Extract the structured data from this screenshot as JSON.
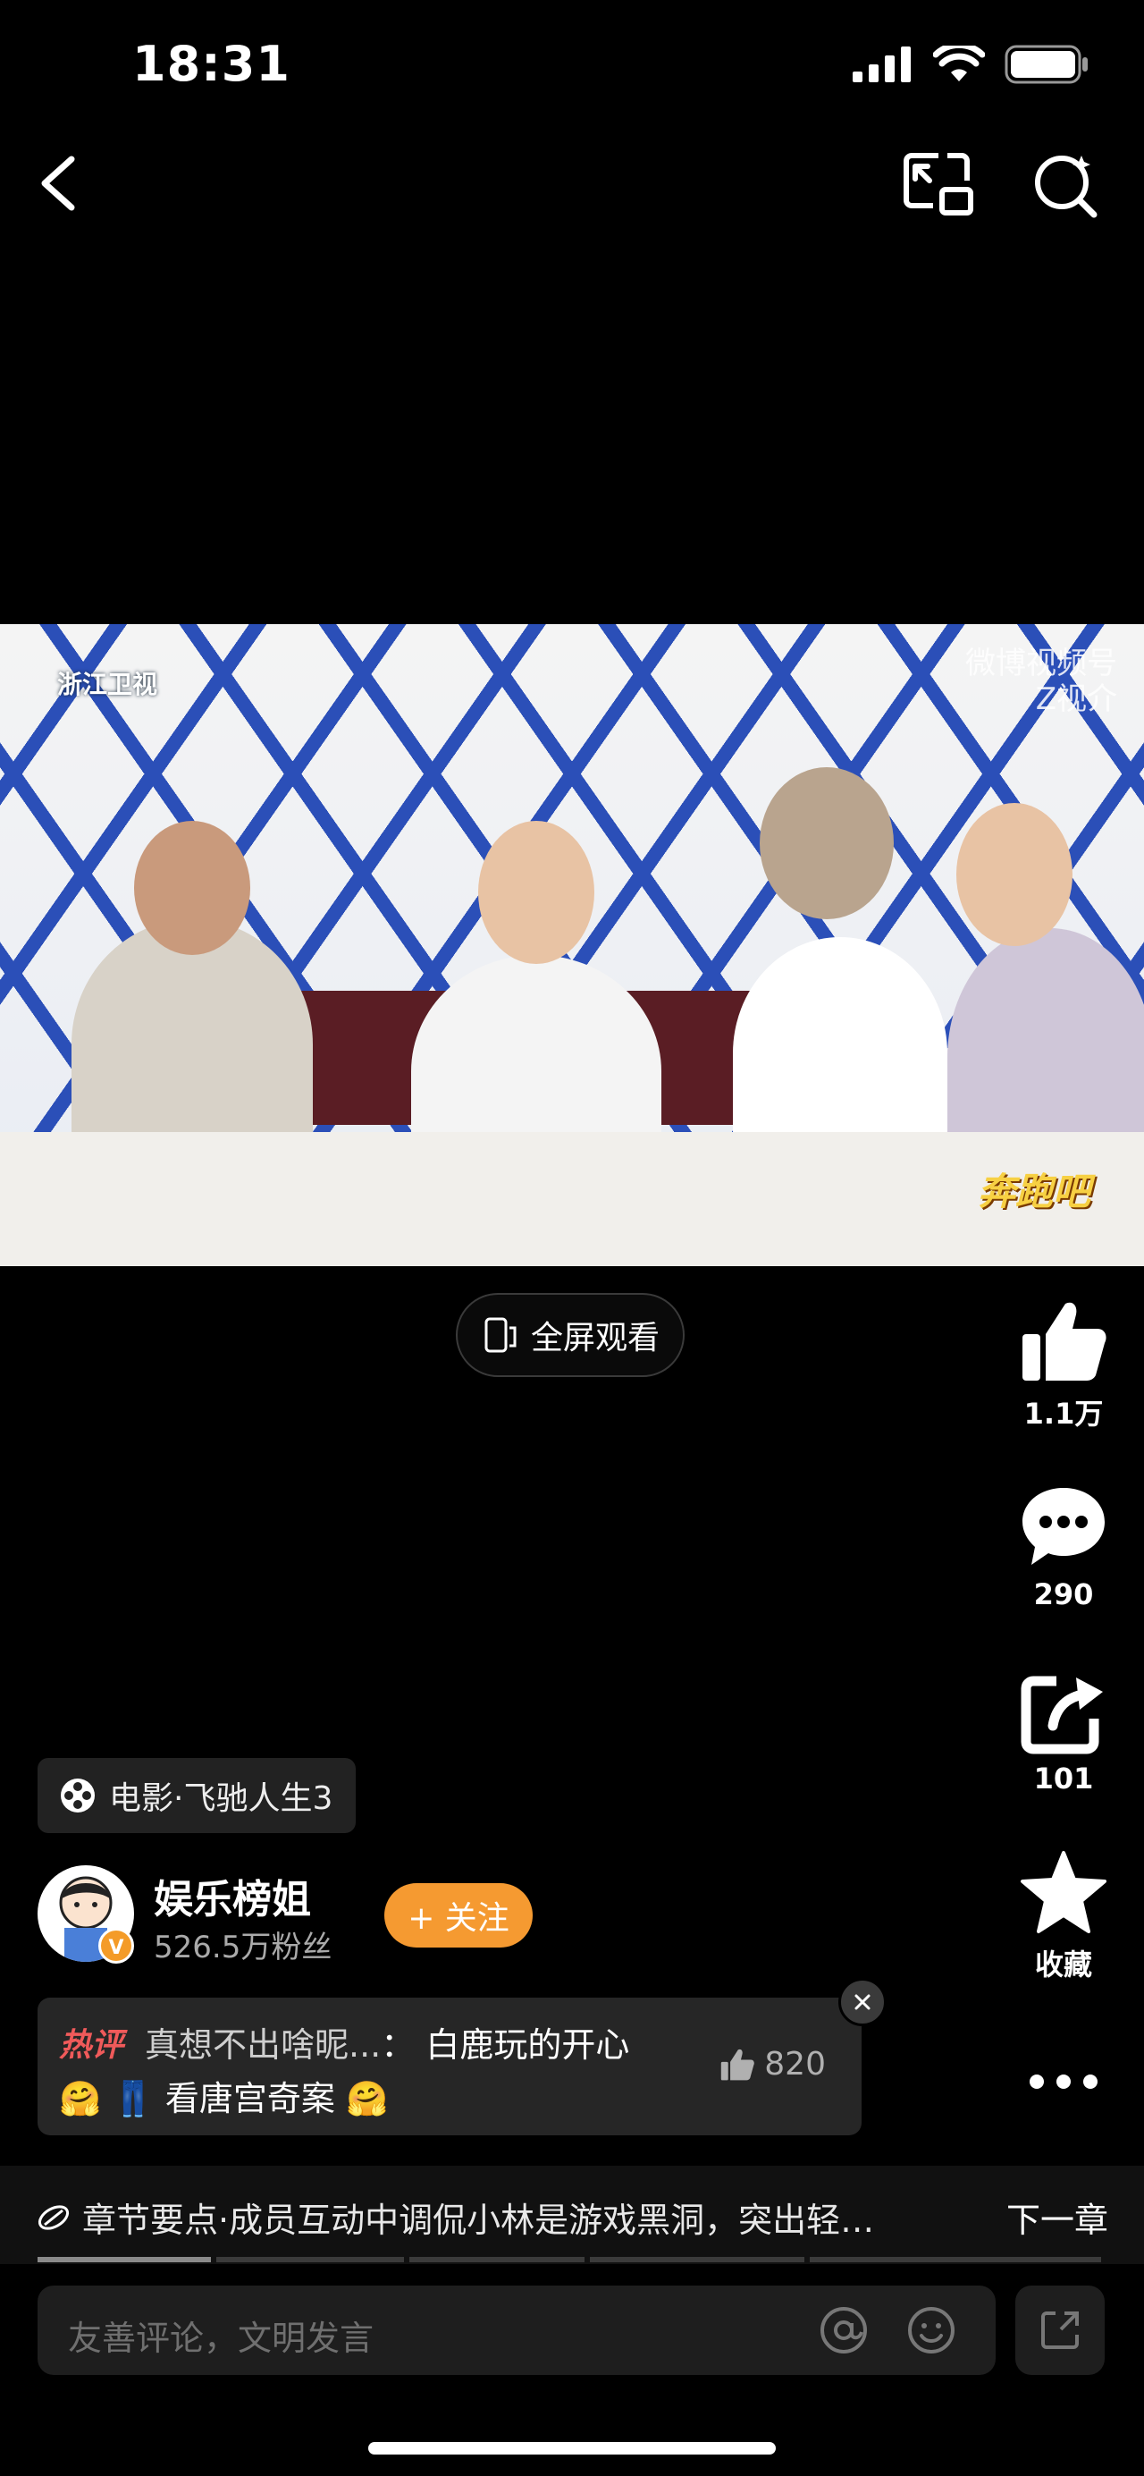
{
  "status_bar": {
    "time": "18:31"
  },
  "actions": {
    "like_count": "1.1万",
    "comment_count": "290",
    "share_count": "101",
    "favorite_label": "收藏"
  },
  "fullscreen_label": "全屏观看",
  "video": {
    "channel_logo": "浙江卫视",
    "watermark_line1": "微博视频号",
    "watermark_line2": "Z视介",
    "show_logo": "奔跑吧"
  },
  "chip_label": "电影·飞驰人生3",
  "author": {
    "name": "娱乐榜姐",
    "fans": "526.5万粉丝",
    "follow_label": "+ 关注"
  },
  "hot_comment": {
    "tag": "热评",
    "user": "真想不出啥昵...",
    "text_line1": "：  白鹿玩的开心",
    "text_line2": "看唐宫奇案",
    "likes": "820"
  },
  "chapter": {
    "text": "章节要点·成员互动中调侃小林是游戏黑洞，突出轻…",
    "next_label": "下一章"
  },
  "comment_input": {
    "placeholder": "友善评论，文明发言"
  }
}
